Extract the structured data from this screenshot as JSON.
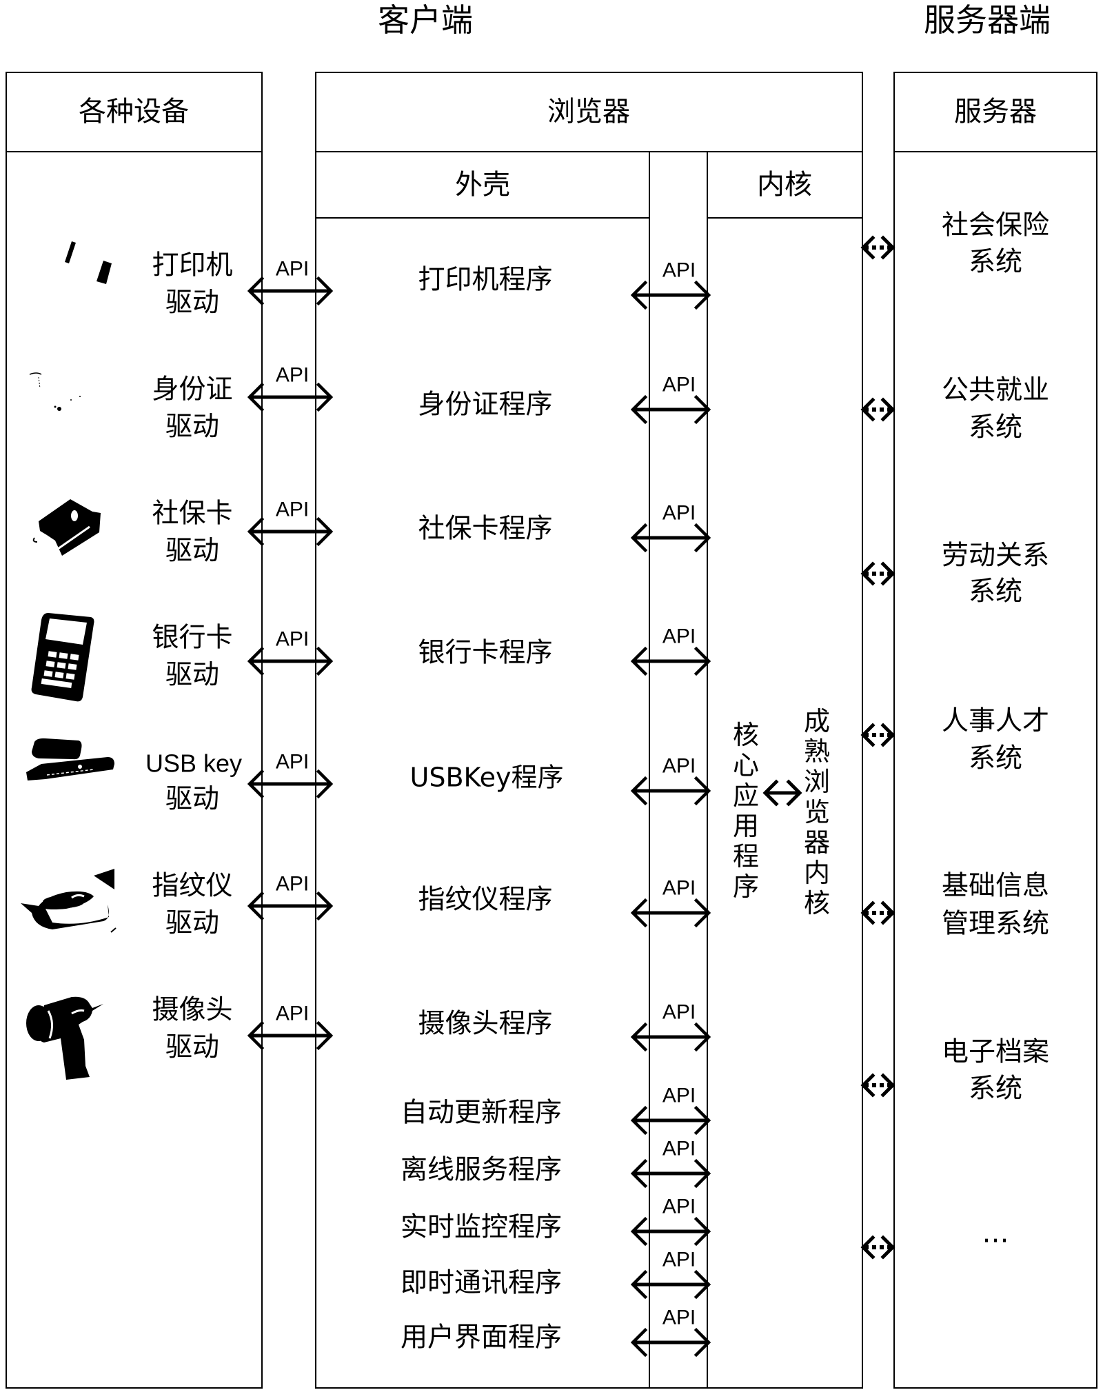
{
  "titles": {
    "client": "客户端",
    "server": "服务器端"
  },
  "devices": {
    "header": "各种设备",
    "items": [
      {
        "icon": "printer-icon",
        "line1": "打印机",
        "line2": "驱动"
      },
      {
        "icon": "id-card-reader-icon",
        "line1": "身份证",
        "line2": "驱动"
      },
      {
        "icon": "social-security-card-reader-icon",
        "line1": "社保卡",
        "line2": "驱动"
      },
      {
        "icon": "bank-card-pos-icon",
        "line1": "银行卡",
        "line2": "驱动"
      },
      {
        "icon": "usb-key-icon",
        "line1": "USB key",
        "line2": "驱动"
      },
      {
        "icon": "fingerprint-scanner-icon",
        "line1": "指纹仪",
        "line2": "驱动"
      },
      {
        "icon": "camera-icon",
        "line1": "摄像头",
        "line2": "驱动"
      }
    ]
  },
  "browser": {
    "header": "浏览器",
    "shell": {
      "header": "外壳",
      "programs": [
        "打印机程序",
        "身份证程序",
        "社保卡程序",
        "银行卡程序",
        "USBKey程序",
        "指纹仪程序",
        "摄像头程序",
        "自动更新程序",
        "离线服务程序",
        "实时监控程序",
        "即时通讯程序",
        "用户界面程序"
      ]
    },
    "kernel": {
      "header": "内核",
      "core_app": "核心应用程序",
      "mature_kernel": "成熟浏览器内核"
    },
    "api_label": "API"
  },
  "server": {
    "header": "服务器",
    "systems": [
      {
        "line1": "社会保险",
        "line2": "系统"
      },
      {
        "line1": "公共就业",
        "line2": "系统"
      },
      {
        "line1": "劳动关系",
        "line2": "系统"
      },
      {
        "line1": "人事人才",
        "line2": "系统"
      },
      {
        "line1": "基础信息",
        "line2": "管理系统"
      },
      {
        "line1": "电子档案",
        "line2": "系统"
      },
      {
        "line1": "…",
        "line2": ""
      }
    ]
  }
}
